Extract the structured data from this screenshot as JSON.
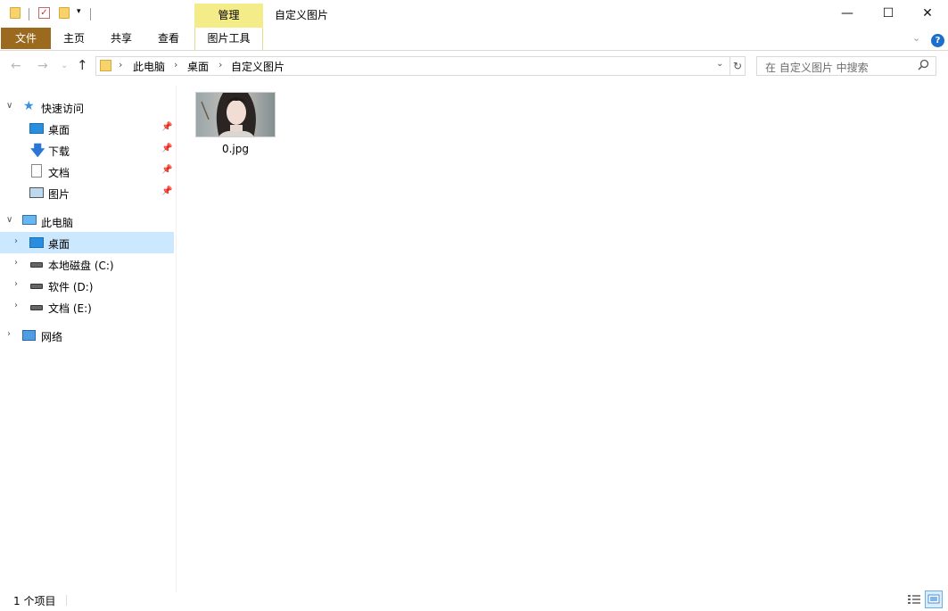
{
  "window": {
    "title": "自定义图片",
    "minimize_glyph": "—",
    "maximize_glyph": "☐",
    "close_glyph": "✕"
  },
  "ribbon": {
    "contextual_group": "管理",
    "tabs": [
      "文件",
      "主页",
      "共享",
      "查看",
      "图片工具"
    ],
    "help_glyph": "?",
    "collapse_glyph": "⌄",
    "file_tab_color": "#9b6a1e",
    "contextual_color": "#f4ec88"
  },
  "address": {
    "back_glyph": "←",
    "forward_glyph": "→",
    "recent_glyph": "⌄",
    "up_glyph": "↑",
    "crumbs": [
      "此电脑",
      "桌面",
      "自定义图片"
    ],
    "crumb_sep": "›",
    "dropdown_glyph": "⌄",
    "refresh_glyph": "↻"
  },
  "search": {
    "placeholder": "在 自定义图片 中搜索",
    "icon": "search-icon"
  },
  "sidebar": {
    "quick_access": "快速访问",
    "quick_items": [
      "桌面",
      "下载",
      "文档",
      "图片"
    ],
    "this_pc": "此电脑",
    "pc_items": [
      "桌面",
      "本地磁盘 (C:)",
      "软件 (D:)",
      "文档 (E:)"
    ],
    "network": "网络",
    "pin_glyph": "📌",
    "selected_color": "#cce8ff"
  },
  "content": {
    "files": [
      {
        "name": "0.jpg",
        "type": "image-thumbnail"
      }
    ]
  },
  "status": {
    "item_count": "1 个项目"
  }
}
